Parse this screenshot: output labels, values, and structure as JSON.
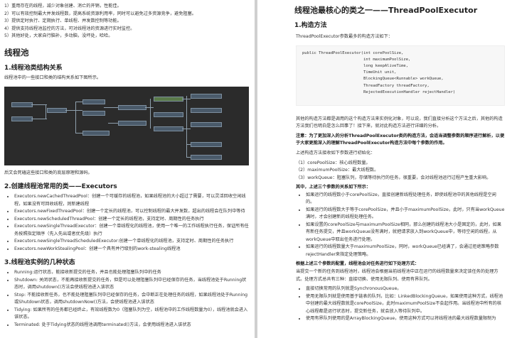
{
  "left": {
    "intro_list": [
      "1）重用存在的线程，减少对象创建、消亡的开销，性能佳。",
      "2）可以有效控制最大并发线程数，提高系统资源利用率，同时可以避免过多资源竞争，避免阻塞。",
      "3）提供定时执行、定期执行、单线程、并发数控制等功能。",
      "4）提供支持线程池监控的方法，可对线程池的资源进行实时监控。",
      "5）其他好处，大家自行脑补，多动脑，没坏处，哈哈。"
    ],
    "heading_pool": "线程池",
    "sec1_title": "1.线程池类结构关系",
    "sec1_text": "线程池中的一些接口和类的结构关系如下图所示。",
    "after_diagram": "后文会死磕这些接口和类的底层原理和源码。",
    "sec2_title": "2.创建线程池常用的类——Executors",
    "executors": [
      "Executors.newCachedThreadPool：创建一个可缓存的线程池，如果线程池的大小超过了需要，可以灵活回收空闲线程，如果没有可回收线程，则新建线程",
      "Executors.newFixedThreadPool：创建一个定长的线程池，可以控制线程的最大并发数，超出的线程会在队列中等待",
      "Executors.newScheduledThreadPool：创建一个定长的线程池，支持定时、周期性的任务执行",
      "Executors.newSingleThreadExecutor：创建一个单线程化的线程池，使用一个唯一的工作线程执行任务，保证所有任务按照指定顺序（先入先出或者优先级）执行",
      "Executors.newSingleThreadScheduledExecutor:创建一个单线程化的线程池，支持定时、周期性的任务执行",
      "Executors.newWorkStealingPool：创建一个具有并行级别的work-stealing线程池"
    ],
    "sec3_title": "3.线程池实例的几种状态",
    "states": [
      "Running:运行状态，能接收新提交的任务，并且也能处理阻塞队列中的任务",
      "Shutdown: 关闭状态，不能再接收新提交的任务，但是可以处理阻塞队列中已经保存的任务，当线程池处于Running状态时，调用shutdown()方法会使线程池进入该状态",
      "Stop: 不能接收新任务，也不能处理阻塞队列中已经保存的任务，会中断正在处理任务的线程，如果线程池处于Running或Shutdown状态，调用shutdownNow()方法，会使线程池进入该状态",
      "Tidying: 如果所有的任务都已经终止，有效线程数为0（阻塞队列为空，线程池中的工作线程数量为0），线程池就会进入该状态。",
      "Terminated: 处于Tidying状态的线程池调用terminated()方法，会使用线程池进入该状态"
    ]
  },
  "right": {
    "title": "线程池最核心的类之一——ThreadPoolExecutor",
    "sec1_title": "1.构造方法",
    "sec1_text": "ThreadPoolExecutor参数最多的构造方法如下：",
    "code_lines": [
      "public ThreadPoolExecutor(int corePoolSize,",
      "                          int maximumPoolSize,",
      "                          long keepAliveTime,",
      "                          TimeUnit unit,",
      "                          BlockingQueue<Runnable> workQueue,",
      "                          ThreadFactory threadFactory,",
      "                          RejectedExecutionHandler rejectHandler)"
    ],
    "para1": "其他的构造方法都是调用的这个构造方法来实例化对象，可以说，我们直接分析这个方法之后，其他的构造方法我们也明白是怎么回事了！接下来，就对此构造方法进行详细的分析。",
    "note": "注意：为了更加深入的分析ThreadPoolExecutor类的构造方法，会适当调整参数的顺序进行解析，以便于大家更能深入的理解ThreadPoolExecutor构造方法中每个参数的作用。",
    "para2": "上述构造方法接收如下参数进行初始化：",
    "params": [
      "（1）corePoolSize：核心线程数量。",
      "（2）maximumPoolSize：最大线程数。",
      "（3）workQueue：阻塞队列，存储等待执行的任务，很重要，会对线程池运行过程产生重大影响。"
    ],
    "rel_title": "其中，上述三个参数的关系如下所示：",
    "rel_list": [
      "如果运行的线程数小于corePoolSize，直接创建新线程处理任务，即使线程池中的其他线程是空闲的。",
      "如果运行的线程数大于等于corePoolSize，并且小于maximumPoolSize，此时，只有当workQueue满时，才会创建新的线程处理任务。",
      "如果设置的corePoolSize与maximumPoolSize相同，那么创建的线程池大小是固定的，此时，如果有新任务提交，并且workQueue没有满时，就把请求放入到workQueue中，等待空闲的线程，从workQueue中取出任务进行处理。",
      "如果运行的线程数量大于maximumPoolSize，同时，workQueue已经满了，会通过拒绝策略参数rejectHandler来指定处理策略。"
    ],
    "cfg_title": "根据上述三个参数的配置，线程池会对任务进行如下处理方式：",
    "cfg_text": "当提交一个新的任务到线程池时，线程池会根据当前线程池中正在运行的线程数量来决定该任务的处理方式。处理方式总共有三种：直接切换、使用无限队列、使用有界队列。",
    "cfg_list": [
      "直接切换常用的队列就是SynchronousQueue。",
      "使用无限队列就是使用基于链表的队列，比如：LinkedBlockingQueue，如果使用这种方式，线程池中创建的最大线程数就是corePoolSize，此时maximumPoolSize不会起作用。当线程池中所有的核心线程都是运行状态时，提交新任务，就会放入等待队列中。",
      "使用有界队列使用的是ArrayBlockingQueue，使用这种方式可以将线程池的最大线程数量限制为"
    ]
  }
}
